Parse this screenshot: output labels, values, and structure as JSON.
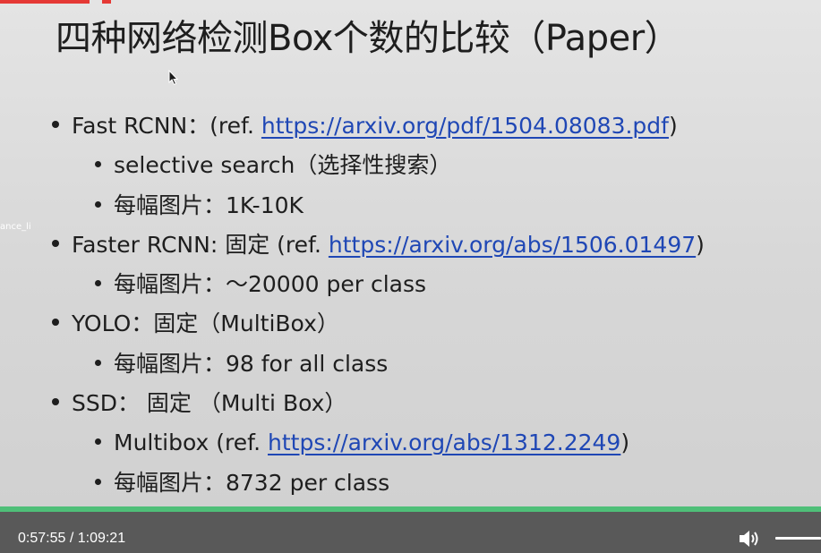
{
  "slide": {
    "title": "四种网络检测Box个数的比较（Paper）",
    "watermark": "ance_li",
    "bullets": [
      {
        "level": 1,
        "prefix": "Fast RCNN：(ref. ",
        "link": "https://arxiv.org/pdf/1504.08083.pdf",
        "suffix": ")"
      },
      {
        "level": 2,
        "prefix": "selective search（选择性搜索）",
        "link": "",
        "suffix": ""
      },
      {
        "level": 2,
        "prefix": "每幅图片：1K-10K",
        "link": "",
        "suffix": ""
      },
      {
        "level": 1,
        "prefix": "Faster RCNN: 固定 (ref. ",
        "link": "https://arxiv.org/abs/1506.01497",
        "suffix": ")"
      },
      {
        "level": 2,
        "prefix": "每幅图片：～20000 per class",
        "link": "",
        "suffix": ""
      },
      {
        "level": 1,
        "prefix": "YOLO：固定（MultiBox）",
        "link": "",
        "suffix": ""
      },
      {
        "level": 2,
        "prefix": "每幅图片：98 for all class",
        "link": "",
        "suffix": ""
      },
      {
        "level": 1,
        "prefix": "SSD：  固定 （Multi Box）",
        "link": "",
        "suffix": ""
      },
      {
        "level": 2,
        "prefix": "Multibox (ref. ",
        "link": "https://arxiv.org/abs/1312.2249",
        "suffix": ")"
      },
      {
        "level": 2,
        "prefix": "每幅图片：8732 per class",
        "link": "",
        "suffix": ""
      }
    ]
  },
  "player": {
    "time_display": "0:57:55 / 1:09:21",
    "progress_fraction": 0.835,
    "volume_icon": "speaker-volume-icon",
    "progress_color": "#4fbf78",
    "controls_bg": "#595959"
  },
  "colors": {
    "link": "#1f47b5",
    "text": "#1e1e1e",
    "accent_red": "#e53935"
  }
}
